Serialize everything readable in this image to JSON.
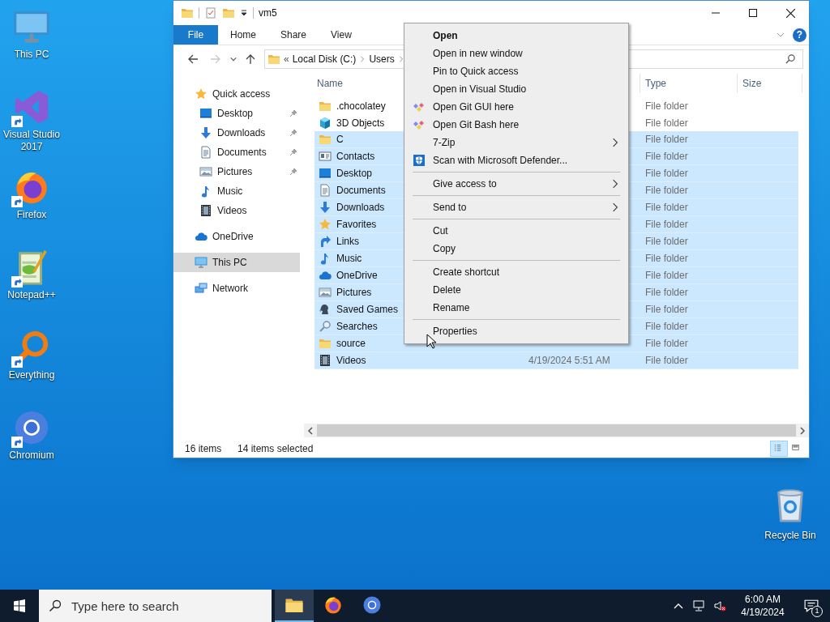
{
  "desktop": {
    "icons": [
      {
        "label": "This PC",
        "kind": "pc",
        "shortcut": false
      },
      {
        "label": "Visual Studio 2017",
        "kind": "vs",
        "shortcut": true
      },
      {
        "label": "Firefox",
        "kind": "firefox",
        "shortcut": true
      },
      {
        "label": "Notepad++",
        "kind": "notepad",
        "shortcut": true
      },
      {
        "label": "Everything",
        "kind": "everything",
        "shortcut": true
      },
      {
        "label": "Chromium",
        "kind": "chromium",
        "shortcut": true
      }
    ],
    "corner_icon": {
      "label": "Recycle Bin",
      "kind": "recycle"
    }
  },
  "explorer": {
    "title": "vm5",
    "ribbon_tabs": [
      {
        "label": "File",
        "selected": true
      },
      {
        "label": "Home",
        "selected": false
      },
      {
        "label": "Share",
        "selected": false
      },
      {
        "label": "View",
        "selected": false
      }
    ],
    "help": "?",
    "address": {
      "overflow": "«",
      "segments": [
        "Local Disk (C:)",
        "Users"
      ]
    },
    "nav": [
      {
        "label": "Quick access",
        "kind": "star",
        "selected": false,
        "children": [
          {
            "label": "Desktop",
            "kind": "desktop",
            "pinned": true,
            "selected": false
          },
          {
            "label": "Downloads",
            "kind": "downloads",
            "pinned": true,
            "selected": false
          },
          {
            "label": "Documents",
            "kind": "documents",
            "pinned": true,
            "selected": false
          },
          {
            "label": "Pictures",
            "kind": "pictures",
            "pinned": true,
            "selected": false
          },
          {
            "label": "Music",
            "kind": "music",
            "pinned": false,
            "selected": false
          },
          {
            "label": "Videos",
            "kind": "videos",
            "pinned": false,
            "selected": false
          }
        ]
      },
      {
        "label": "OneDrive",
        "kind": "cloud",
        "selected": false
      },
      {
        "label": "This PC",
        "kind": "pc",
        "selected": true
      },
      {
        "label": "Network",
        "kind": "network",
        "selected": false
      }
    ],
    "columns": [
      "Name",
      "Type",
      "Size"
    ],
    "rows": [
      {
        "name": ".chocolatey",
        "kind": "folder",
        "type": "File folder",
        "selected": false
      },
      {
        "name": "3D Objects",
        "kind": "cube",
        "type": "File folder",
        "selected": false
      },
      {
        "name": "C",
        "kind": "folder",
        "type": "File folder",
        "selected": true
      },
      {
        "name": "Contacts",
        "kind": "contacts",
        "type": "File folder",
        "selected": true
      },
      {
        "name": "Desktop",
        "kind": "desktop",
        "type": "File folder",
        "selected": true
      },
      {
        "name": "Documents",
        "kind": "documents",
        "type": "File folder",
        "selected": true
      },
      {
        "name": "Downloads",
        "kind": "downloads",
        "type": "File folder",
        "selected": true
      },
      {
        "name": "Favorites",
        "kind": "star",
        "type": "File folder",
        "selected": true
      },
      {
        "name": "Links",
        "kind": "links",
        "type": "File folder",
        "selected": true
      },
      {
        "name": "Music",
        "kind": "music",
        "type": "File folder",
        "selected": true
      },
      {
        "name": "OneDrive",
        "kind": "cloud",
        "type": "File folder",
        "selected": true
      },
      {
        "name": "Pictures",
        "kind": "pictures",
        "type": "File folder",
        "selected": true
      },
      {
        "name": "Saved Games",
        "kind": "games",
        "type": "File folder",
        "selected": true
      },
      {
        "name": "Searches",
        "kind": "search",
        "type": "File folder",
        "selected": true
      },
      {
        "name": "source",
        "kind": "folder",
        "type": "File folder",
        "selected": true
      },
      {
        "name": "Videos",
        "kind": "videos",
        "date": "4/19/2024 5:51 AM",
        "type": "File folder",
        "selected": true
      }
    ],
    "status": {
      "count": "16 items",
      "selection": "14 items selected"
    },
    "views": [
      {
        "kind": "details",
        "selected": true
      },
      {
        "kind": "large",
        "selected": false
      }
    ]
  },
  "context_menu": {
    "sections": [
      [
        {
          "label": "Open",
          "kind": "plain",
          "default": true,
          "submenu": false
        },
        {
          "label": "Open in new window",
          "kind": "plain",
          "default": false,
          "submenu": false
        },
        {
          "label": "Pin to Quick access",
          "kind": "plain",
          "default": false,
          "submenu": false
        },
        {
          "label": "Open in Visual Studio",
          "kind": "plain",
          "default": false,
          "submenu": false
        },
        {
          "label": "Open Git GUI here",
          "kind": "git",
          "default": false,
          "submenu": false
        },
        {
          "label": "Open Git Bash here",
          "kind": "git",
          "default": false,
          "submenu": false
        },
        {
          "label": "7-Zip",
          "kind": "plain",
          "default": false,
          "submenu": true
        },
        {
          "label": "Scan with Microsoft Defender...",
          "kind": "shield",
          "default": false,
          "submenu": false
        }
      ],
      [
        {
          "label": "Give access to",
          "kind": "plain",
          "default": false,
          "submenu": true
        }
      ],
      [
        {
          "label": "Send to",
          "kind": "plain",
          "default": false,
          "submenu": true
        }
      ],
      [
        {
          "label": "Cut",
          "kind": "plain",
          "default": false,
          "submenu": false
        },
        {
          "label": "Copy",
          "kind": "plain",
          "default": false,
          "submenu": false
        }
      ],
      [
        {
          "label": "Create shortcut",
          "kind": "plain",
          "default": false,
          "submenu": false
        },
        {
          "label": "Delete",
          "kind": "plain",
          "default": false,
          "submenu": false
        },
        {
          "label": "Rename",
          "kind": "plain",
          "default": false,
          "submenu": false
        }
      ],
      [
        {
          "label": "Properties",
          "kind": "plain",
          "default": false,
          "submenu": false
        }
      ]
    ]
  },
  "taskbar": {
    "search_placeholder": "Type here to search",
    "apps": [
      {
        "kind": "explorer",
        "active": true
      },
      {
        "kind": "firefox",
        "active": false
      },
      {
        "kind": "chromium",
        "active": false
      }
    ],
    "time": "6:00 AM",
    "date": "4/19/2024",
    "notifications": "1"
  }
}
